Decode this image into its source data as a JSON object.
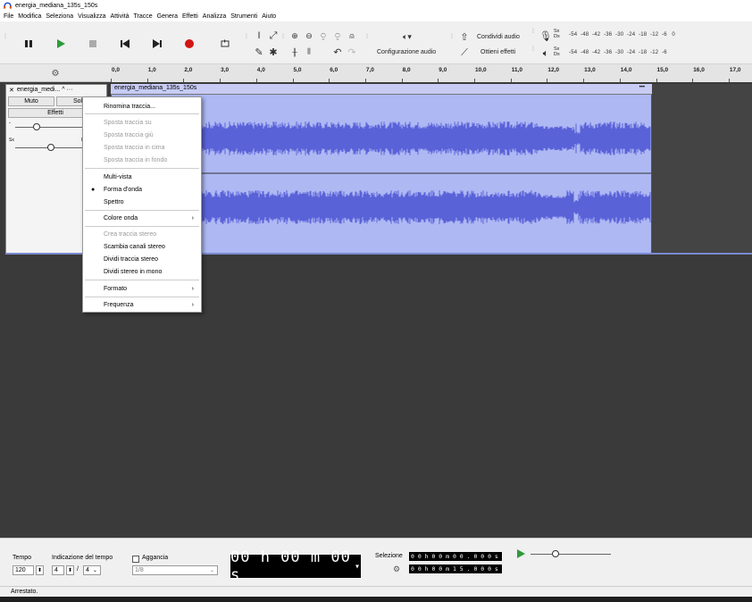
{
  "window": {
    "title": "energia_mediana_135s_150s"
  },
  "menubar": [
    "File",
    "Modifica",
    "Seleziona",
    "Visualizza",
    "Attività",
    "Tracce",
    "Genera",
    "Effetti",
    "Analizza",
    "Strumenti",
    "Aiuto"
  ],
  "toolbar": {
    "config_audio_label": "Configurazione audio",
    "share_audio_label": "Condividi audio",
    "get_effects_label": "Ottieni effetti",
    "meter_rec_channels": "Sx\nDx",
    "meter_scale": "-54  -48  -42  -36  -30  -24  -18  -12  -6   0",
    "meter_play_scale": "-54  -48  -42  -36  -30  -24  -18  -12  -6"
  },
  "ruler": {
    "labels": [
      "0,0",
      "1,0",
      "2,0",
      "3,0",
      "4,0",
      "5,0",
      "6,0",
      "7,0",
      "8,0",
      "9,0",
      "10,0",
      "11,0",
      "12,0",
      "13,0",
      "14,0",
      "15,0",
      "16,0",
      "17,0"
    ]
  },
  "track": {
    "name": "energia_medi...",
    "mute_label": "Muto",
    "solo_label": "Solo",
    "effects_label": "Effetti",
    "pan_left": "Sx",
    "pan_right": "D",
    "clip_name": "energia_mediana_135s_150s",
    "clip_menu": "•••"
  },
  "context_menu": {
    "items": [
      {
        "label": "Rinomina traccia...",
        "enabled": true
      },
      {
        "label": "Sposta traccia su",
        "enabled": false
      },
      {
        "label": "Sposta traccia giù",
        "enabled": false
      },
      {
        "label": "Sposta traccia in cima",
        "enabled": false
      },
      {
        "label": "Sposta traccia in fondo",
        "enabled": false
      },
      {
        "label": "Multi-vista",
        "enabled": true
      },
      {
        "label": "Forma d'onda",
        "enabled": true,
        "checked": true
      },
      {
        "label": "Spettro",
        "enabled": true
      },
      {
        "label": "Colore onda",
        "enabled": true,
        "submenu": true
      },
      {
        "label": "Crea traccia stereo",
        "enabled": false
      },
      {
        "label": "Scambia canali stereo",
        "enabled": true
      },
      {
        "label": "Dividi traccia stereo",
        "enabled": true
      },
      {
        "label": "Dividi stereo in mono",
        "enabled": true
      },
      {
        "label": "Formato",
        "enabled": true,
        "submenu": true
      },
      {
        "label": "Frequenza",
        "enabled": true,
        "submenu": true
      }
    ]
  },
  "bottom": {
    "tempo_label": "Tempo",
    "tempo_value": "120",
    "time_sig_label": "Indicazione del tempo",
    "time_sig_num": "4",
    "time_sig_sep": "/",
    "time_sig_den": "4",
    "snap_label": "Aggancia",
    "snap_value": "1/8",
    "time_display": "00 h 00 m 00 s",
    "selection_label": "Selezione",
    "sel_start": "0 0 h 0 0 m 0 0 . 0 0 0 s",
    "sel_end": "0 0 h 0 0 m 1 5 . 0 0 0 s",
    "scroll_left": "<"
  },
  "status": {
    "text": "Arrestato."
  },
  "colors": {
    "waveform": "#5a62d8",
    "clip_bg": "#aeb8f3",
    "record": "#d21414",
    "play": "#2e9a3a"
  }
}
